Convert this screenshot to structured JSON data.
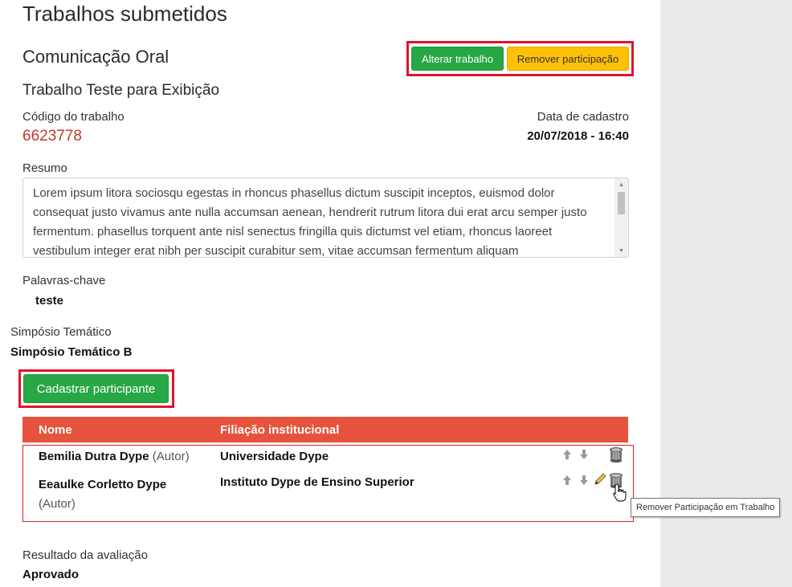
{
  "page": {
    "title": "Trabalhos submetidos"
  },
  "work": {
    "type": "Comunicação Oral",
    "title": "Trabalho Teste para Exibição",
    "code_label": "Código do trabalho",
    "code_value": "6623778",
    "date_label": "Data de cadastro",
    "date_value": "20/07/2018 - 16:40",
    "summary_label": "Resumo",
    "summary_text": "Lorem ipsum litora sociosqu egestas in rhoncus phasellus dictum suscipit inceptos, euismod dolor consequat justo vivamus ante nulla accumsan aenean, hendrerit rutrum litora dui erat arcu semper justo fermentum. phasellus torquent ante nisl senectus fringilla quis dictumst vel etiam, rhoncus laoreet vestibulum integer erat nibh per suscipit curabitur sem, vitae accumsan fermentum aliquam",
    "keywords_label": "Palavras-chave",
    "keywords_value": "teste",
    "symposium_label": "Simpósio Temático",
    "symposium_value": "Simpósio Temático B",
    "result_label": "Resultado da avaliação",
    "result_value": "Aprovado"
  },
  "actions": {
    "edit_label": "Alterar trabalho",
    "remove_label": "Remover participação",
    "add_participant_label": "Cadastrar participante"
  },
  "participants": {
    "columns": [
      "Nome",
      "Filiação institucional"
    ],
    "rows": [
      {
        "name": "Bemilia Dutra Dype",
        "role": "(Autor)",
        "affiliation": "Universidade Dype"
      },
      {
        "name": "Eeaulke Corletto Dype",
        "role": "(Autor)",
        "affiliation": "Instituto Dype de Ensino Superior"
      }
    ]
  },
  "tooltip": {
    "text": "Remover Participação em Trabalho"
  },
  "colors": {
    "green": "#28a745",
    "yellow": "#ffc107",
    "table_header": "#e5533d",
    "highlight": "#e0142b",
    "code": "#c0392b"
  },
  "icons": {
    "row_actions": [
      "arrow-up-icon",
      "arrow-down-icon",
      "pencil-icon",
      "trash-icon"
    ]
  }
}
